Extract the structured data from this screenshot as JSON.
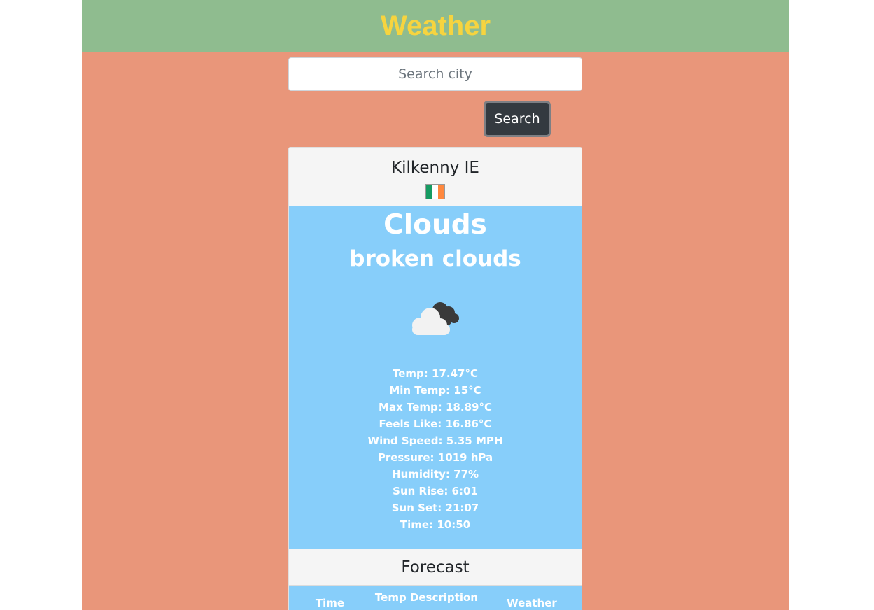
{
  "header": {
    "title": "Weather"
  },
  "search": {
    "placeholder": "Search city",
    "value": "",
    "button_label": "Search"
  },
  "location": {
    "city": "Kilkenny IE",
    "flag_icon": "ireland-flag-icon",
    "flag_colors": [
      "#169b62",
      "#ffffff",
      "#ff883e"
    ]
  },
  "current": {
    "main": "Clouds",
    "description": "broken clouds",
    "icon": "broken-clouds-icon",
    "details": [
      "Temp: 17.47°C",
      "Min Temp: 15°C",
      "Max Temp: 18.89°C",
      "Feels Like: 16.86°C",
      "Wind Speed: 5.35 MPH",
      "Pressure: 1019 hPa",
      "Humidity: 77%",
      "Sun Rise: 6:01",
      "Sun Set: 21:07",
      "Time: 10:50"
    ]
  },
  "forecast": {
    "title": "Forecast",
    "columns": [
      "Time",
      "Temp Description",
      "Weather"
    ]
  },
  "colors": {
    "page_bg": "#e9967a",
    "navbar_bg": "#8fbc8f",
    "title_color": "#f6d43f",
    "weather_bg": "#87cefa",
    "button_bg": "#343a40"
  }
}
